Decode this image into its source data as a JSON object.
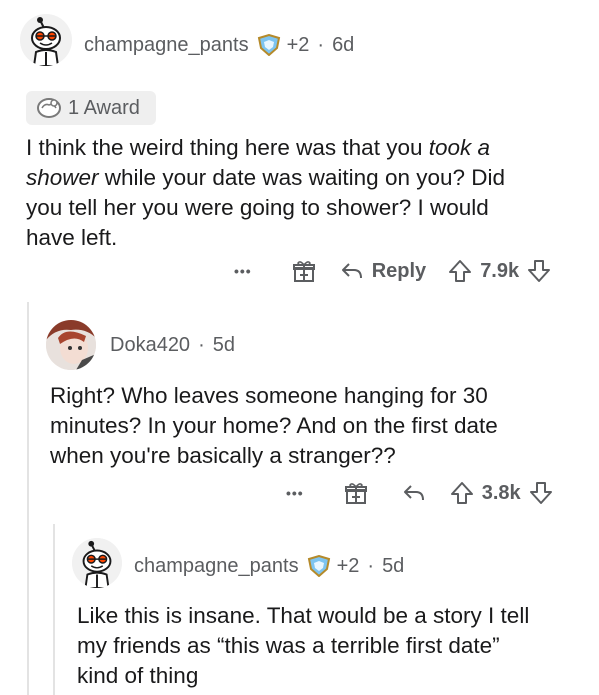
{
  "comments": [
    {
      "username": "champagne_pants",
      "extra": "+2",
      "age": "6d",
      "award_label": "1 Award",
      "body_lines": [
        "I think the weird thing here was that you <i>took a</i>",
        "<i>shower</i> while your date was waiting on you? Did",
        "you tell her you were going to shower? I would",
        "have left."
      ],
      "actions": {
        "more": "•••",
        "reply": "Reply",
        "score": "7.9k"
      }
    },
    {
      "username": "Doka420",
      "age": "5d",
      "body_lines": [
        "Right? Who leaves someone hanging for 30",
        "minutes? In your home? And on the first date",
        "when you're basically a stranger??"
      ],
      "actions": {
        "more": "•••",
        "score": "3.8k"
      }
    },
    {
      "username": "champagne_pants",
      "extra": "+2",
      "age": "5d",
      "body_lines": [
        "Like this is insane. That would be a story I tell",
        "my friends as “this was a terrible first date”",
        "kind of thing"
      ]
    }
  ],
  "separator": "·",
  "colors": {
    "meta": "#5b5d60",
    "text": "#1a1a1b",
    "thread": "#e3e3e3",
    "award_bg": "#efefef"
  },
  "icons": [
    "snoo-avatar-icon",
    "award-badge-icon",
    "silver-award-icon",
    "gift-award-icon",
    "reply-arrow-icon",
    "upvote-icon",
    "downvote-icon",
    "more-icon"
  ]
}
